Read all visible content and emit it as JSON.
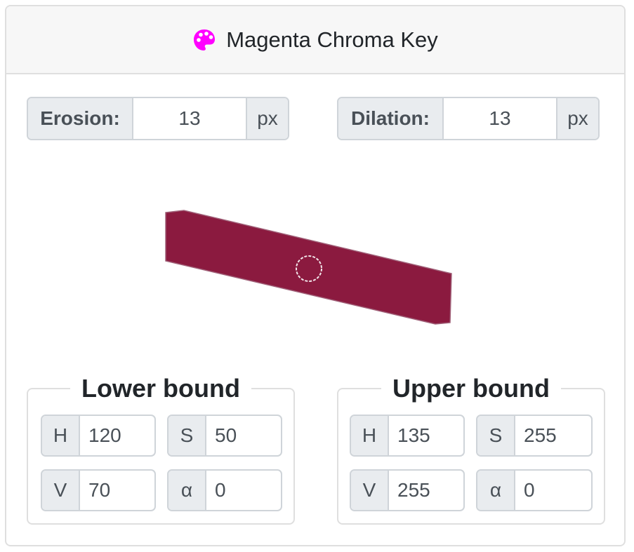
{
  "header": {
    "title": "Magenta Chroma Key",
    "icon": "palette-icon",
    "icon_color": "#ff00ff"
  },
  "erosion": {
    "label": "Erosion:",
    "value": "13",
    "unit": "px"
  },
  "dilation": {
    "label": "Dilation:",
    "value": "13",
    "unit": "px"
  },
  "preview": {
    "shape_color": "#8b1a3f",
    "cursor": "circle-cursor-icon"
  },
  "lower_bound": {
    "legend": "Lower bound",
    "h": {
      "label": "H",
      "value": "120"
    },
    "s": {
      "label": "S",
      "value": "50"
    },
    "v": {
      "label": "V",
      "value": "70"
    },
    "a": {
      "label": "α",
      "value": "0"
    }
  },
  "upper_bound": {
    "legend": "Upper bound",
    "h": {
      "label": "H",
      "value": "135"
    },
    "s": {
      "label": "S",
      "value": "255"
    },
    "v": {
      "label": "V",
      "value": "255"
    },
    "a": {
      "label": "α",
      "value": "0"
    }
  }
}
